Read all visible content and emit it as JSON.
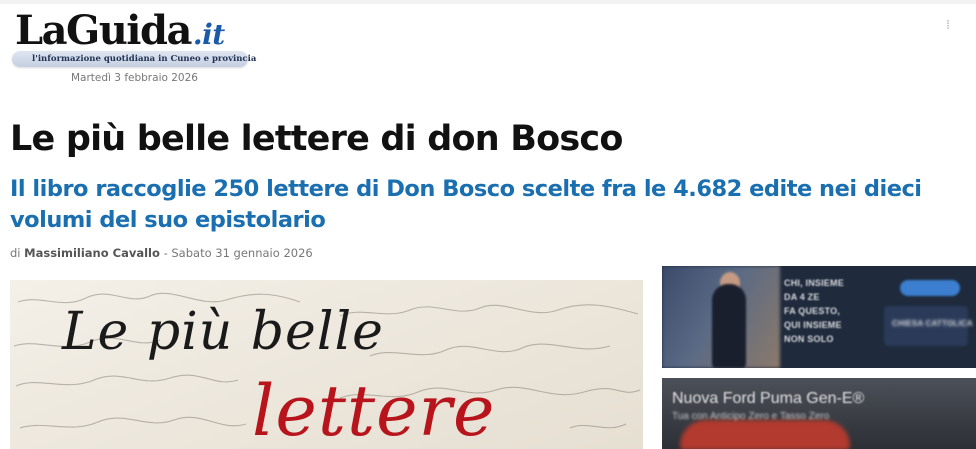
{
  "masthead": {
    "logo_word": "LaGuida",
    "logo_suffix": ".it",
    "tagline": "l'informazione quotidiana in Cuneo e provincia",
    "date": "Martedì 3 febbraio 2026",
    "right_glyph": "⁞"
  },
  "article": {
    "title": "Le più belle lettere di don Bosco",
    "subtitle": "Il libro raccoglie 250 lettere di Don Bosco scelte fra le 4.682 edite nei dieci volumi del suo epistolario",
    "byline_prefix": "di",
    "author": "Massimiliano Cavallo",
    "byline_separator": "-",
    "published": "Sabato 31 gennaio 2026"
  },
  "cover_image": {
    "line1": "Le più belle",
    "line2": "lettere",
    "handwriting_color": "#8a8378",
    "title_color": "#1a1a1a",
    "accent_color": "#b8141c"
  },
  "ads": [
    {
      "name": "chiesa-cattolica-banner",
      "lines": [
        "CHI, INSIEME",
        "DA 4 ZE",
        "FA QUESTO,",
        "QUI INSIEME",
        "NON SOLO"
      ],
      "badge": "CHIESA CATTOLICA"
    },
    {
      "name": "ford-puma-banner",
      "title": "Nuova Ford Puma Gen-E®",
      "subtitle": "Tua con Anticipo Zero e Tasso Zero"
    }
  ],
  "colors": {
    "headline": "#111111",
    "subhead": "#1a6fb0",
    "meta": "#777777"
  }
}
